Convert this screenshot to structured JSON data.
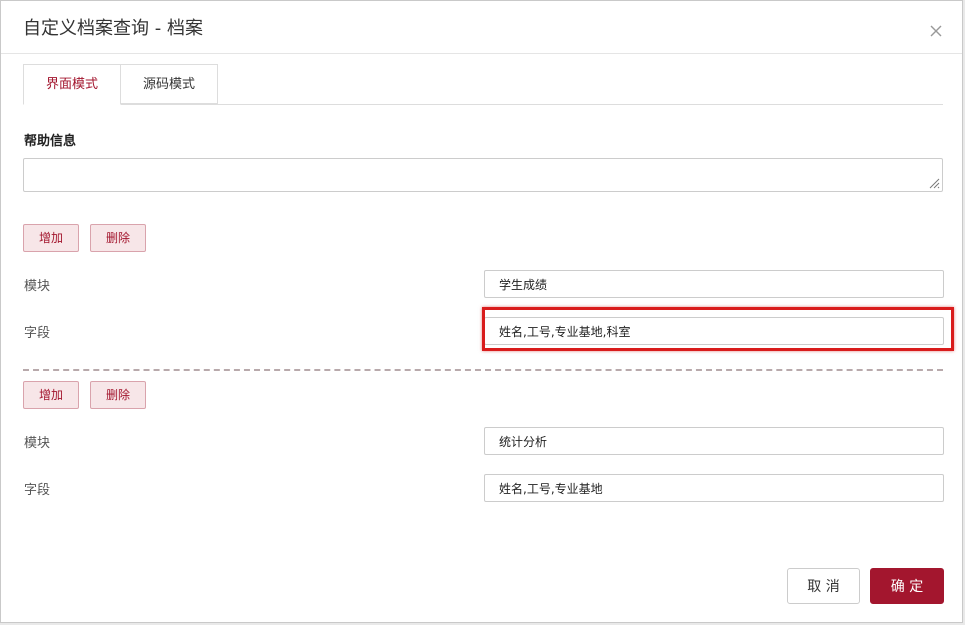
{
  "dialog": {
    "title": "自定义档案查询 - 档案",
    "close_icon": "close-icon"
  },
  "tabs": [
    {
      "label": "界面模式",
      "active": true
    },
    {
      "label": "源码模式",
      "active": false
    }
  ],
  "help": {
    "label": "帮助信息",
    "value": ""
  },
  "groups": [
    {
      "add_label": "增加",
      "delete_label": "删除",
      "module_label": "模块",
      "module_value": "学生成绩",
      "field_label": "字段",
      "field_value": "姓名,工号,专业基地,科室",
      "highlighted": true
    },
    {
      "add_label": "增加",
      "delete_label": "删除",
      "module_label": "模块",
      "module_value": "统计分析",
      "field_label": "字段",
      "field_value": "姓名,工号,专业基地",
      "highlighted": false
    }
  ],
  "footer": {
    "cancel_label": "取 消",
    "ok_label": "确 定"
  },
  "colors": {
    "accent": "#a3162e",
    "highlight": "#d91c1c"
  }
}
